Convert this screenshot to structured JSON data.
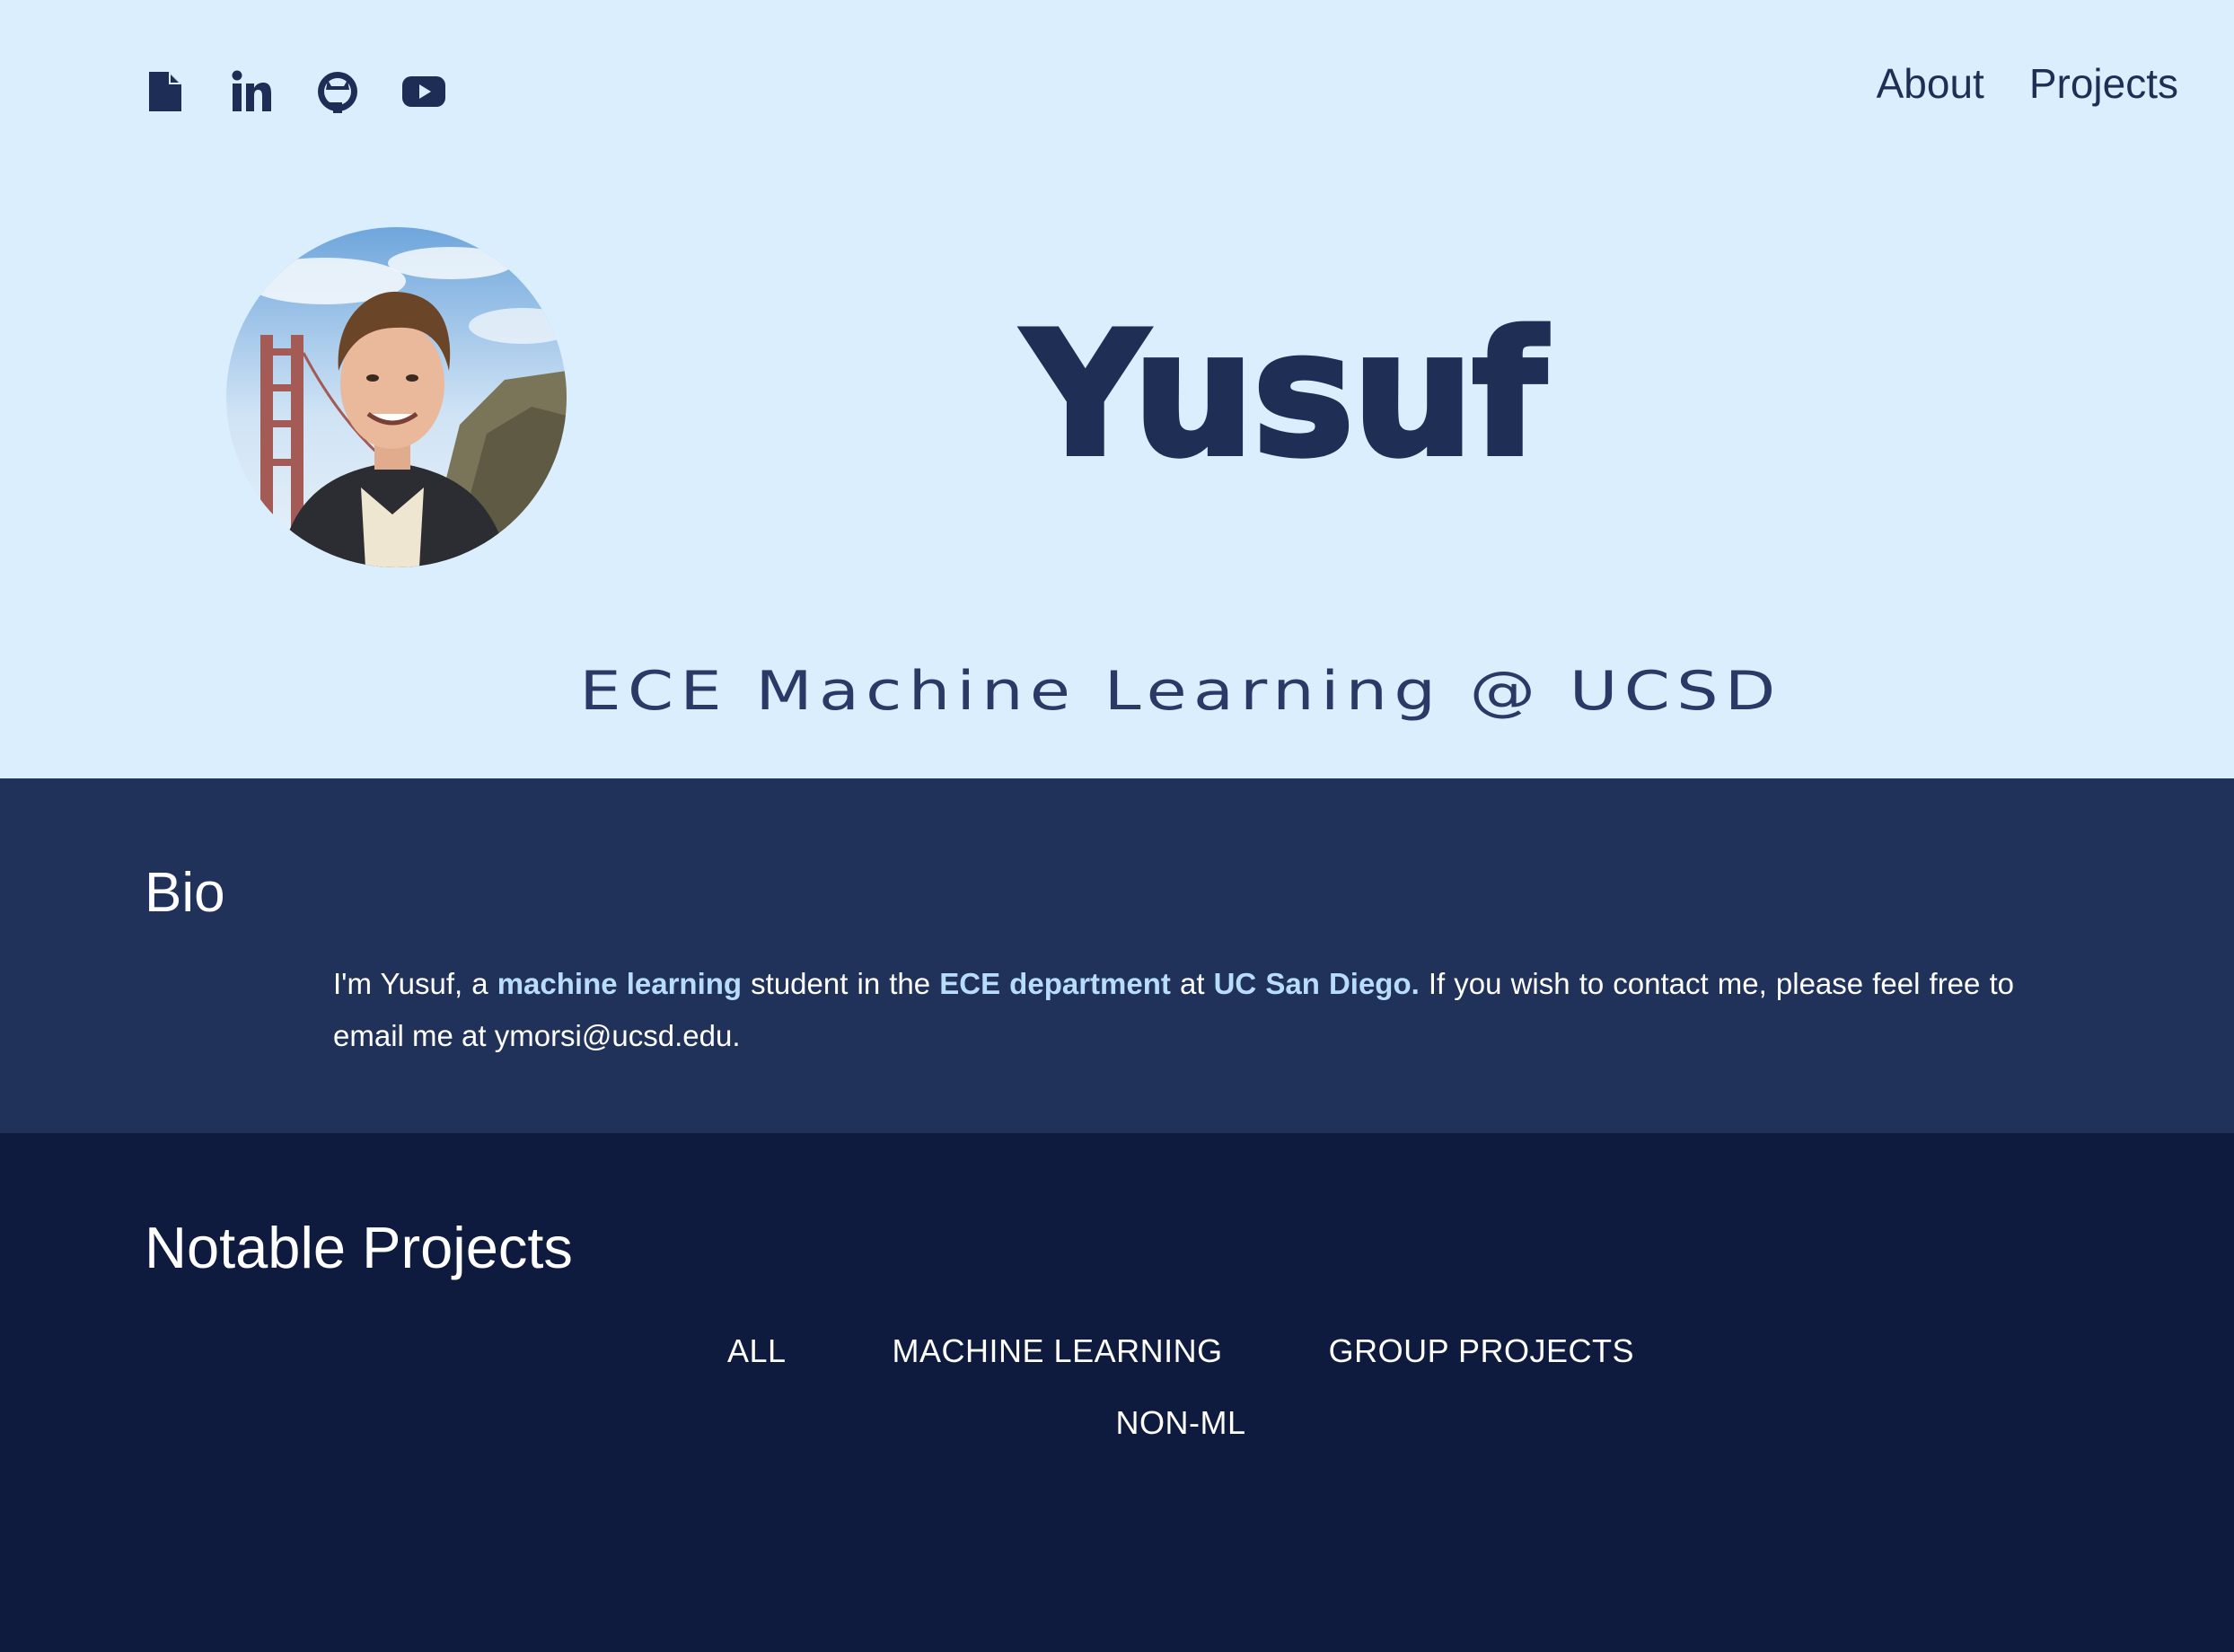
{
  "social_links": [
    {
      "icon": "resume-icon",
      "label": "Resume"
    },
    {
      "icon": "linkedin-icon",
      "label": "LinkedIn"
    },
    {
      "icon": "github-icon",
      "label": "GitHub"
    },
    {
      "icon": "youtube-icon",
      "label": "YouTube"
    }
  ],
  "nav": {
    "about": "About",
    "projects": "Projects"
  },
  "hero": {
    "name": "Yusuf",
    "tagline": "ECE Machine Learning @ UCSD"
  },
  "bio": {
    "heading": "Bio",
    "intro": "I'm Yusuf, a ",
    "hl1": "machine learning",
    "mid1": " student in the ",
    "hl2": "ECE department",
    "mid2": " at ",
    "hl3": "UC San Diego.",
    "outro": " If you wish to contact me, please feel free to email me at ymorsi@ucsd.edu."
  },
  "projects": {
    "heading": "Notable Projects",
    "filters": [
      "ALL",
      "MACHINE LEARNING",
      "GROUP PROJECTS",
      "NON-ML"
    ]
  },
  "colors": {
    "hero_bg": "#dbeefd",
    "bio_bg": "#21325a",
    "projects_bg": "#0f1b3e",
    "accent_text": "#1f2e55",
    "highlight": "#b8ddfb"
  }
}
